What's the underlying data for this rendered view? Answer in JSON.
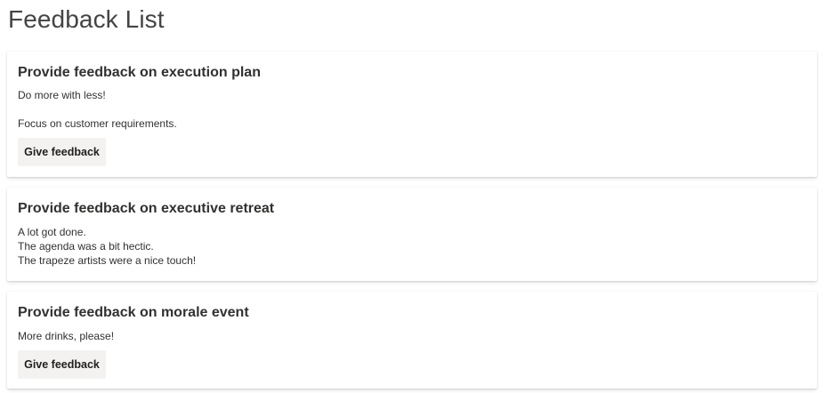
{
  "page": {
    "title": "Feedback List"
  },
  "items": [
    {
      "title": "Provide feedback on execution plan",
      "lines": [
        "Do more with less!",
        "Focus on customer requirements."
      ],
      "button_label": "Give feedback"
    },
    {
      "title": "Provide feedback on executive retreat",
      "lines": [
        "A lot got done.",
        "The agenda was a bit hectic.",
        "The trapeze artists were a nice touch!"
      ]
    },
    {
      "title": "Provide feedback on morale event",
      "lines": [
        "More drinks, please!"
      ],
      "button_label": "Give feedback"
    }
  ]
}
